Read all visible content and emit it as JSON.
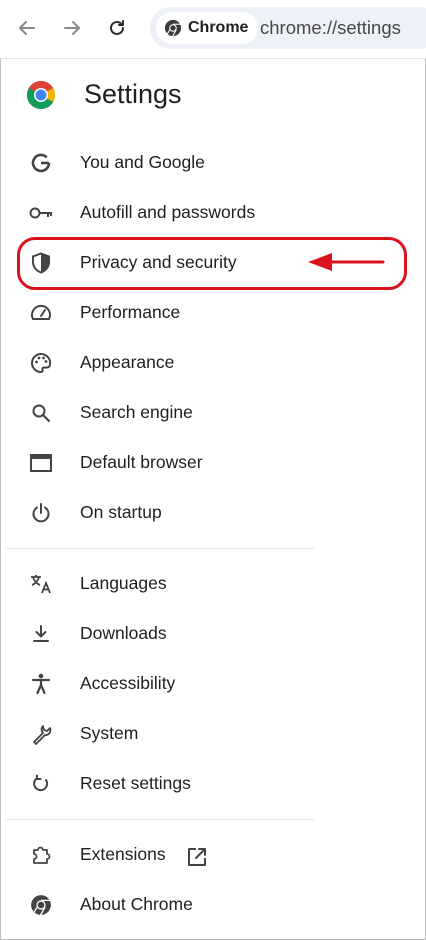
{
  "browser": {
    "chip_label": "Chrome",
    "url": "chrome://settings",
    "icons": [
      "back-arrow-icon",
      "forward-arrow-icon",
      "reload-icon",
      "chrome-logo-icon"
    ]
  },
  "settings": {
    "title": "Settings",
    "menu": [
      {
        "label": "You and Google",
        "icon": "google-g-icon"
      },
      {
        "label": "Autofill and passwords",
        "icon": "key-icon"
      },
      {
        "label": "Privacy and security",
        "icon": "shield-icon",
        "highlighted": true
      },
      {
        "label": "Performance",
        "icon": "speedometer-icon"
      },
      {
        "label": "Appearance",
        "icon": "palette-icon"
      },
      {
        "label": "Search engine",
        "icon": "search-icon"
      },
      {
        "label": "Default browser",
        "icon": "browser-window-icon"
      },
      {
        "label": "On startup",
        "icon": "power-icon"
      },
      {
        "label": "Languages",
        "icon": "translate-icon"
      },
      {
        "label": "Downloads",
        "icon": "download-icon"
      },
      {
        "label": "Accessibility",
        "icon": "accessibility-icon"
      },
      {
        "label": "System",
        "icon": "wrench-icon"
      },
      {
        "label": "Reset settings",
        "icon": "reset-icon"
      },
      {
        "label": "Extensions",
        "icon": "puzzle-icon"
      },
      {
        "label": "About Chrome",
        "icon": "chrome-logo-icon"
      }
    ]
  },
  "annotation": {
    "highlight_color": "#d8131c"
  }
}
